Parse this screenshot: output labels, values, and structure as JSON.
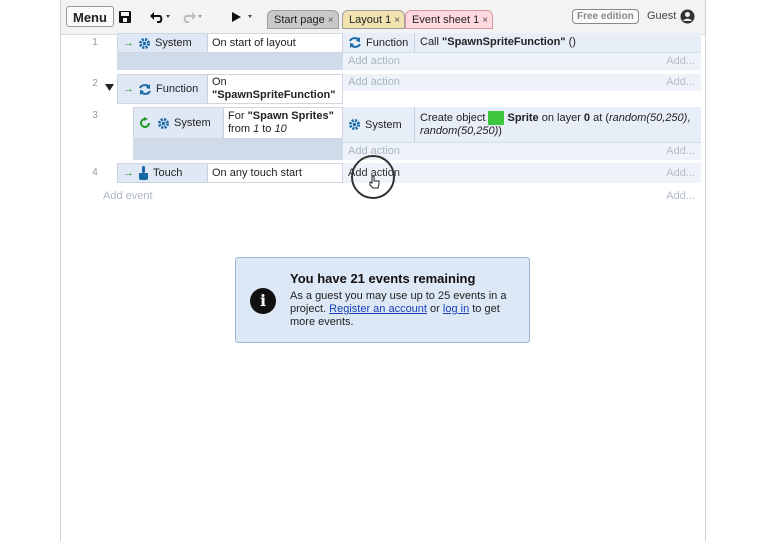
{
  "toolbar": {
    "menu_label": "Menu",
    "tabs": [
      {
        "label": "Start page",
        "close": "×"
      },
      {
        "label": "Layout 1",
        "close": "×"
      },
      {
        "label": "Event sheet 1",
        "close": "×"
      }
    ],
    "edition_badge": "Free edition",
    "guest_label": "Guest"
  },
  "events": [
    {
      "number": "1",
      "condition_object": "System",
      "condition_text": "On start of layout",
      "action_object": "Function",
      "action_prefix": "Call ",
      "action_bold": "\"SpawnSpriteFunction\"",
      "action_suffix": " ()",
      "add_action": "Add action",
      "add_dots": "Add..."
    },
    {
      "number": "2",
      "condition_object": "Function",
      "condition_line1": "On",
      "condition_line2": "\"SpawnSpriteFunction\"",
      "add_action": "Add action",
      "add_dots": "Add..."
    },
    {
      "number": "3",
      "condition_object": "System",
      "condition_line1_prefix": "For ",
      "condition_line1_bold": "\"Spawn Sprites\"",
      "condition_line2_prefix": "from ",
      "condition_line2_i1": "1",
      "condition_line2_mid": " to ",
      "condition_line2_i2": "10",
      "action_object": "System",
      "action_line1_prefix": "Create object ",
      "action_line1_bold": "Sprite",
      "action_line1_mid": " on layer ",
      "action_line1_bold2": "0",
      "action_line1_at": " at (",
      "action_line1_italic": "random(50,250)",
      "action_line1_comma": ",",
      "action_line2_italic": "random(50,250)",
      "action_line2_close": ")",
      "add_action": "Add action",
      "add_dots": "Add..."
    },
    {
      "number": "4",
      "condition_object": "Touch",
      "condition_text": "On any touch start",
      "add_action": "Add action",
      "add_dots": "Add..."
    }
  ],
  "add_event": "Add event",
  "add_event_dots": "Add...",
  "notice": {
    "title": "You have 21 events remaining",
    "body_1": "As a guest you may use up to 25 events in a project. ",
    "register_link": "Register an account",
    "body_2": " or ",
    "login_link": "log in",
    "body_3": " to get more events."
  },
  "colors": {
    "accent_green": "#1c9a27",
    "sprite_green": "#3ec63e",
    "active_tab": "#ffd9dd",
    "inactive_tab": "#c9c9c9",
    "layout_tab": "#f0e3b0"
  }
}
